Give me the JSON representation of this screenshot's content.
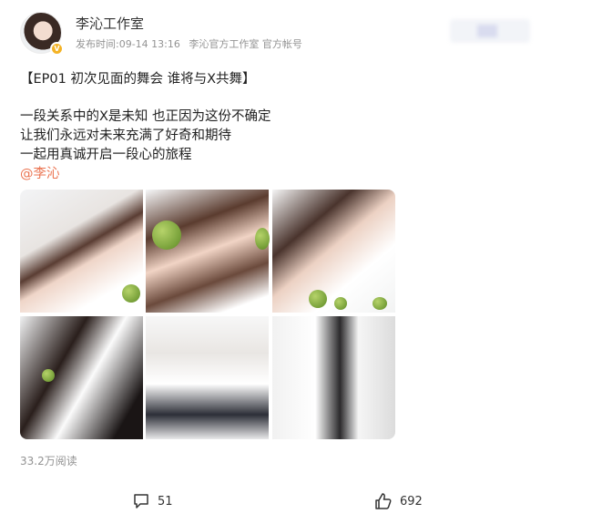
{
  "post": {
    "author": "李沁工作室",
    "meta": {
      "time": "发布时间:09-14  13:16",
      "account_tag": "李沁官方工作室 官方帐号"
    },
    "title": "【EP01 初次见面的舞会 谁将与X共舞】",
    "lines": [
      "一段关系中的X是未知 也正因为这份不确定",
      "让我们永远对未来充满了好奇和期待",
      "一起用真诚开启一段心的旅程"
    ],
    "mention": "@李沁",
    "reads": "33.2万阅读"
  },
  "actions": {
    "comments": "51",
    "likes": "692"
  },
  "icons": [
    "verified-badge-icon",
    "comment-icon",
    "like-icon"
  ],
  "colors": {
    "mention": "#eb7350",
    "verify": "#f4b325"
  }
}
